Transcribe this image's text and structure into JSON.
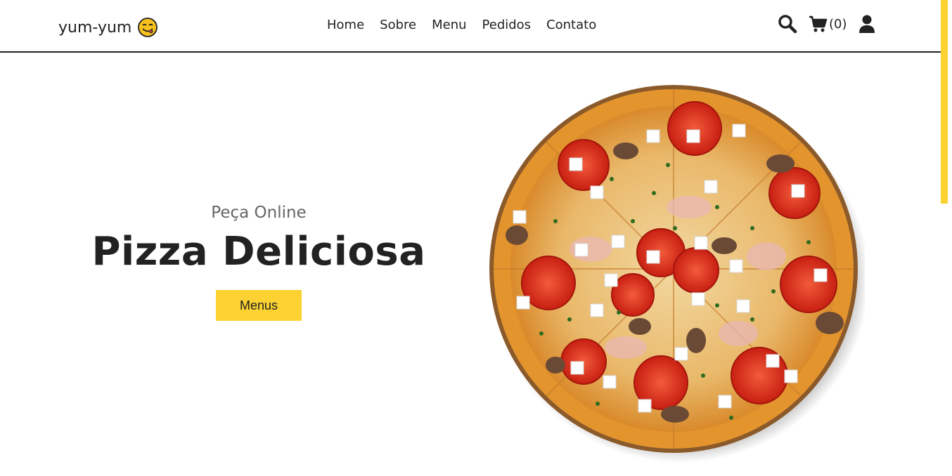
{
  "header": {
    "logo_text": "yum-yum",
    "logo_icon": "smiling-face-savoring-food-icon",
    "nav": [
      "Home",
      "Sobre",
      "Menu",
      "Pedidos",
      "Contato"
    ],
    "cart_count": "(0)",
    "icons": [
      "search-icon",
      "cart-icon",
      "user-icon"
    ]
  },
  "hero": {
    "subtitle": "Peça Online",
    "title": "Pizza Deliciosa",
    "button_label": "Menus",
    "image": "pizza-image"
  },
  "colors": {
    "accent": "#fbd232",
    "text": "#222222",
    "subtitle": "#666666"
  }
}
